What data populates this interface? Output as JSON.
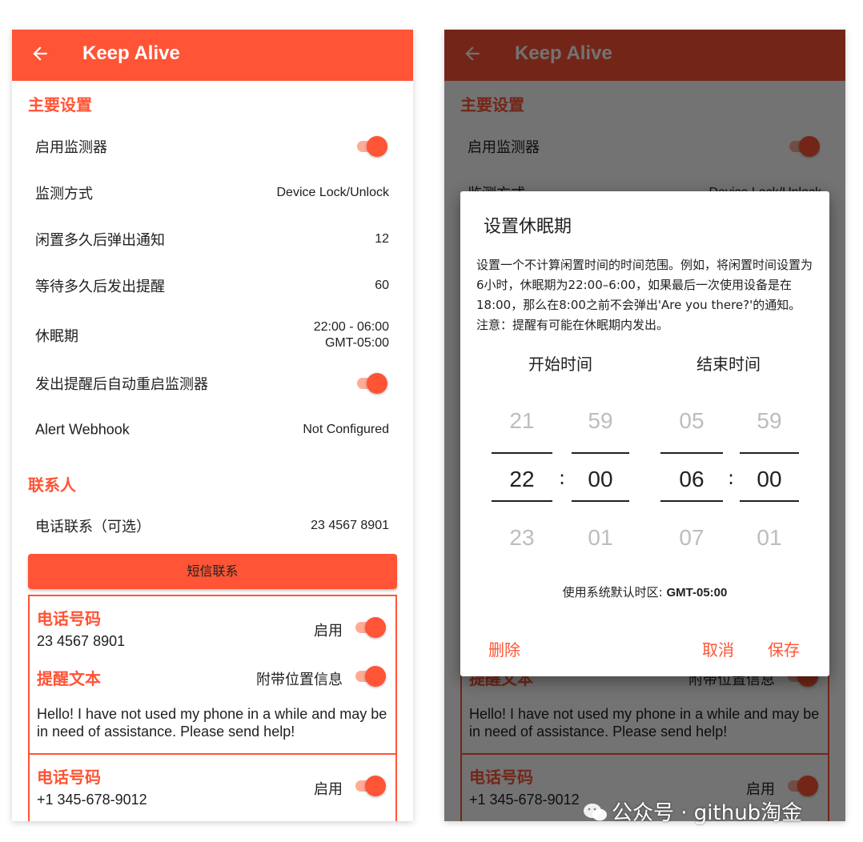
{
  "app": {
    "title": "Keep Alive",
    "accent_color": "#ff5436"
  },
  "main_settings": {
    "header": "主要设置",
    "enable_monitor": {
      "label": "启用监测器",
      "enabled": true
    },
    "monitor_mode": {
      "label": "监测方式",
      "value": "Device Lock/Unlock"
    },
    "idle_notify": {
      "label": "闲置多久后弹出通知",
      "value": "12"
    },
    "wait_alert": {
      "label": "等待多久后发出提醒",
      "value": "60"
    },
    "rest_period": {
      "label": "休眠期",
      "value_line1": "22:00 - 06:00",
      "value_line2": "GMT-05:00"
    },
    "auto_restart": {
      "label": "发出提醒后自动重启监测器",
      "enabled": true
    },
    "webhook": {
      "label": "Alert Webhook",
      "value": "Not Configured"
    }
  },
  "contacts": {
    "header": "联系人",
    "phone_contact": {
      "label": "电话联系（可选）",
      "value": "23 4567 8901"
    },
    "sms_button": "短信联系",
    "cards": [
      {
        "phone_title": "电话号码",
        "phone": "23 4567 8901",
        "enable_label": "启用",
        "enabled": true,
        "text_title": "提醒文本",
        "location_label": "附带位置信息",
        "location_enabled": true,
        "message": "Hello! I have not used my phone in a while and may be in need of assistance. Please send help!"
      },
      {
        "phone_title": "电话号码",
        "phone": "+1 345-678-9012",
        "enable_label": "启用",
        "enabled": true
      }
    ]
  },
  "dialog": {
    "title": "设置休眠期",
    "description": "设置一个不计算闲置时间的时间范围。例如，将闲置时间设置为6小时，休眠期为22:00–6:00，如果最后一次使用设备是在18:00，那么在8:00之前不会弹出'Are you there?'的通知。注意：提醒有可能在休眠期内发出。",
    "start_label": "开始时间",
    "end_label": "结束时间",
    "start_hour": {
      "prev": "21",
      "selected": "22",
      "next": "23"
    },
    "start_minute": {
      "prev": "59",
      "selected": "00",
      "next": "01"
    },
    "end_hour": {
      "prev": "05",
      "selected": "06",
      "next": "07"
    },
    "end_minute": {
      "prev": "59",
      "selected": "00",
      "next": "01"
    },
    "colon": ":",
    "timezone_prefix": "使用系统默认时区:",
    "timezone_value": "GMT-05:00",
    "delete_button": "删除",
    "cancel_button": "取消",
    "save_button": "保存"
  },
  "watermark": {
    "text": "公众号 · github淘金"
  }
}
